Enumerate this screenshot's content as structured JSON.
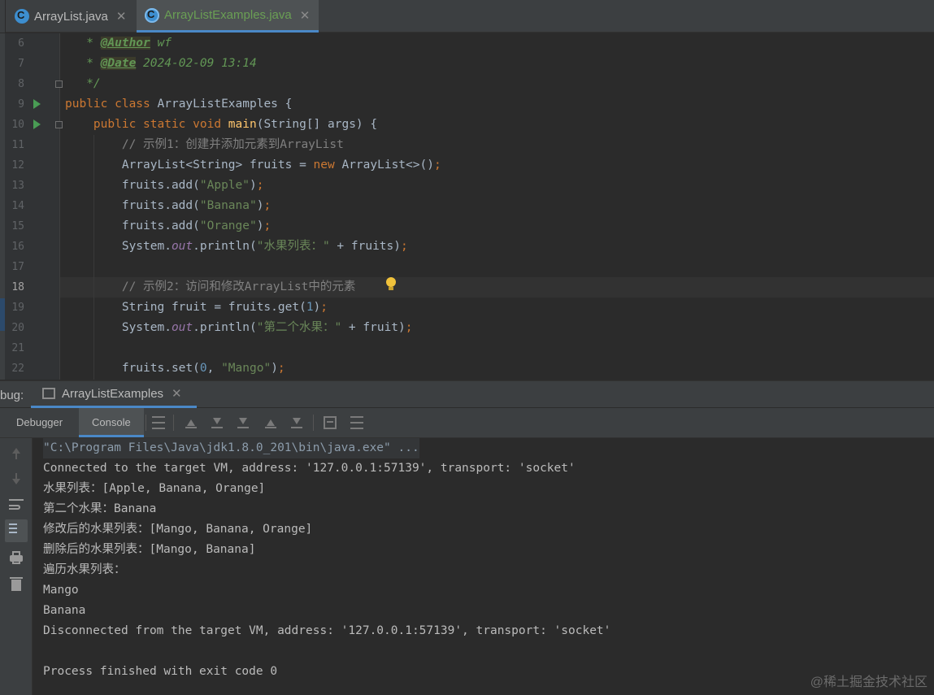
{
  "tabs": [
    {
      "label": "ArrayList.java",
      "active": false
    },
    {
      "label": "ArrayListExamples.java",
      "active": true
    }
  ],
  "editor": {
    "lines": [
      {
        "num": "6",
        "tokens": [
          [
            "doc",
            "   * "
          ],
          [
            "tag",
            "@Author"
          ],
          [
            "doc",
            " wf"
          ]
        ]
      },
      {
        "num": "7",
        "tokens": [
          [
            "doc",
            "   * "
          ],
          [
            "tag",
            "@Date"
          ],
          [
            "doc",
            " 2024-02-09 13:14"
          ]
        ]
      },
      {
        "num": "8",
        "tokens": [
          [
            "doc",
            "   */"
          ]
        ]
      },
      {
        "num": "9",
        "tokens": [
          [
            "kw",
            "public class "
          ],
          [
            "plain",
            "ArrayListExamples {"
          ]
        ]
      },
      {
        "num": "10",
        "tokens": [
          [
            "plain",
            "    "
          ],
          [
            "kw",
            "public static void "
          ],
          [
            "fn",
            "main"
          ],
          [
            "plain",
            "(String[] args) {"
          ]
        ]
      },
      {
        "num": "11",
        "tokens": [
          [
            "cmt",
            "        // 示例1：创建并添加元素到ArrayList"
          ]
        ]
      },
      {
        "num": "12",
        "tokens": [
          [
            "plain",
            "        ArrayList<String> fruits = "
          ],
          [
            "kw",
            "new "
          ],
          [
            "plain",
            "ArrayList<>()"
          ],
          [
            "kw",
            ";"
          ]
        ]
      },
      {
        "num": "13",
        "tokens": [
          [
            "plain",
            "        fruits.add("
          ],
          [
            "str",
            "\"Apple\""
          ],
          [
            "plain",
            ")"
          ],
          [
            "kw",
            ";"
          ]
        ]
      },
      {
        "num": "14",
        "tokens": [
          [
            "plain",
            "        fruits.add("
          ],
          [
            "str",
            "\"Banana\""
          ],
          [
            "plain",
            ")"
          ],
          [
            "kw",
            ";"
          ]
        ]
      },
      {
        "num": "15",
        "tokens": [
          [
            "plain",
            "        fruits.add("
          ],
          [
            "str",
            "\"Orange\""
          ],
          [
            "plain",
            ")"
          ],
          [
            "kw",
            ";"
          ]
        ]
      },
      {
        "num": "16",
        "tokens": [
          [
            "plain",
            "        System."
          ],
          [
            "fld",
            "out"
          ],
          [
            "plain",
            ".println("
          ],
          [
            "str",
            "\"水果列表：\""
          ],
          [
            "plain",
            " + fruits)"
          ],
          [
            "kw",
            ";"
          ]
        ]
      },
      {
        "num": "17",
        "tokens": []
      },
      {
        "num": "18",
        "tokens": [
          [
            "cmt",
            "        // 示例2：访问和修改ArrayList中的元素"
          ]
        ]
      },
      {
        "num": "19",
        "tokens": [
          [
            "plain",
            "        String fruit = fruits.get("
          ],
          [
            "num",
            "1"
          ],
          [
            "plain",
            ")"
          ],
          [
            "kw",
            ";"
          ]
        ]
      },
      {
        "num": "20",
        "tokens": [
          [
            "plain",
            "        System."
          ],
          [
            "fld",
            "out"
          ],
          [
            "plain",
            ".println("
          ],
          [
            "str",
            "\"第二个水果：\""
          ],
          [
            "plain",
            " + fruit)"
          ],
          [
            "kw",
            ";"
          ]
        ]
      },
      {
        "num": "21",
        "tokens": []
      },
      {
        "num": "22",
        "tokens": [
          [
            "plain",
            "        fruits.set("
          ],
          [
            "num",
            "0"
          ],
          [
            "plain",
            ", "
          ],
          [
            "str",
            "\"Mango\""
          ],
          [
            "plain",
            ")"
          ],
          [
            "kw",
            ";"
          ]
        ]
      }
    ]
  },
  "debug": {
    "label": "bug:",
    "session": "ArrayListExamples",
    "tabs": {
      "debugger": "Debugger",
      "console": "Console"
    }
  },
  "console": {
    "lines": [
      "\"C:\\Program Files\\Java\\jdk1.8.0_201\\bin\\java.exe\" ...",
      "Connected to the target VM, address: '127.0.0.1:57139', transport: 'socket'",
      "水果列表：[Apple, Banana, Orange]",
      "第二个水果：Banana",
      "修改后的水果列表：[Mango, Banana, Orange]",
      "删除后的水果列表：[Mango, Banana]",
      "遍历水果列表：",
      "Mango",
      "Banana",
      "Disconnected from the target VM, address: '127.0.0.1:57139', transport: 'socket'",
      "",
      "Process finished with exit code 0"
    ]
  },
  "watermark": "@稀土掘金技术社区"
}
